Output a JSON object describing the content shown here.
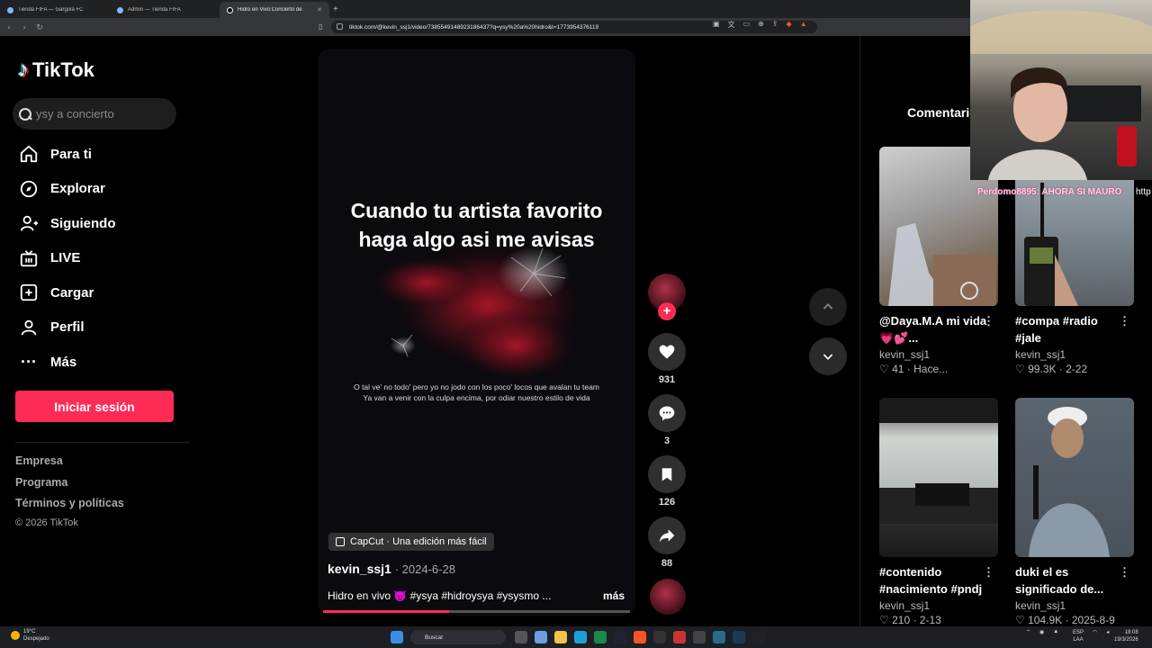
{
  "browser": {
    "tabs": [
      {
        "title": "Tienda FIFA — Gargola FC",
        "active": false
      },
      {
        "title": "Admin — Tienda FIFA",
        "active": false
      },
      {
        "title": "Hidro en Vivo:Concierto de ",
        "active": true
      }
    ],
    "new_tab": "+",
    "url": "tiktok.com/@kevin_ssj1/video/7385549148923186437?q=ysy%20a%20hidro&t=1773954376119"
  },
  "sidebar": {
    "logo": "TikTok",
    "search_placeholder": "ysy a concierto",
    "menu": [
      {
        "label": "Para ti",
        "icon": "home-icon"
      },
      {
        "label": "Explorar",
        "icon": "compass-icon"
      },
      {
        "label": "Siguiendo",
        "icon": "user-follow-icon"
      },
      {
        "label": "LIVE",
        "icon": "live-tv-icon"
      },
      {
        "label": "Cargar",
        "icon": "upload-plus-icon"
      },
      {
        "label": "Perfil",
        "icon": "profile-icon"
      },
      {
        "label": "Más",
        "icon": "more-dots-icon"
      }
    ],
    "login_button": "Iniciar sesión",
    "footer_links": [
      "Empresa",
      "Programa",
      "Términos y políticas"
    ],
    "copyright": "© 2026 TikTok"
  },
  "video": {
    "overlay_text": [
      "Cuando tu artista favorito",
      "haga algo asi me avisas"
    ],
    "lyrics": [
      "O tal ve' no todo' pero yo no jodo con los poco' locos que avalan tu team",
      "Ya van a venir con la culpa encima, por odiar nuestro estilo de vida"
    ],
    "capcut_label": "CapCut · Una edición más fácil",
    "author": "kevin_ssj1",
    "date": "· 2024-6-28",
    "description": "Hidro en vivo 😈 #ysya #hidroysya #ysysmo ...",
    "more": "más",
    "progress": 0.41
  },
  "actions": {
    "follow": "+",
    "likes": "931",
    "comments": "3",
    "saves": "126",
    "shares": "88"
  },
  "right_panel": {
    "tab": "Comentarios",
    "cards": [
      {
        "title": "@Daya.M.A mi vida 💗💕...",
        "author": "kevin_ssj1",
        "likes": "41",
        "time": "Hace..."
      },
      {
        "title": "#compa #radio #jale",
        "author": "kevin_ssj1",
        "likes": "99.3K",
        "time": "2-22"
      },
      {
        "title": "#contenido #nacimiento #pndj",
        "author": "kevin_ssj1",
        "likes": "210",
        "time": "2-13"
      },
      {
        "title": "duki el es significado de...",
        "author": "kevin_ssj1",
        "likes": "104.9K",
        "time": "2025-8-9"
      }
    ]
  },
  "webcam": {
    "overlay_name": "Perdomo8895: AHORA SI MAURO",
    "overlay_trail": "http"
  },
  "taskbar": {
    "weather_temp": "19°C",
    "weather_desc": "Despejado",
    "search": "Buscar",
    "lang_top": "ESP",
    "lang_bottom": "LAA",
    "time": "18:08",
    "date": "19/3/2026"
  },
  "colors": {
    "accent": "#fe2c55",
    "background": "#000000",
    "surface": "#2f2f2f"
  }
}
